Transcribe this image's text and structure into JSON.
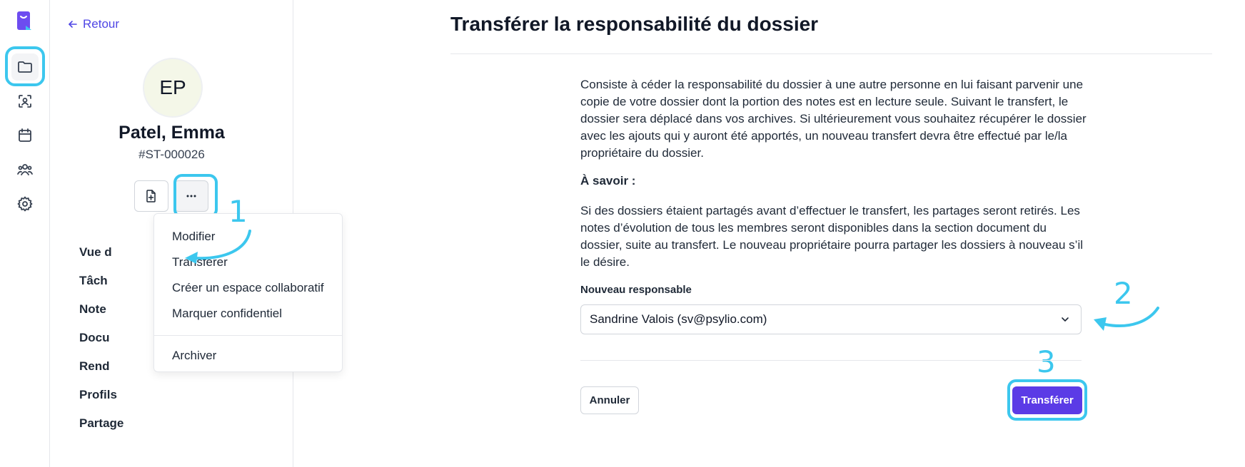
{
  "profile": {
    "back_label": "Retour",
    "initials": "EP",
    "name": "Patel, Emma",
    "file_id": "#ST-000026",
    "sections": [
      "Vue d",
      "Tâch",
      "Note",
      "Docu",
      "Rend",
      "Profils",
      "Partage"
    ]
  },
  "menu": {
    "items": [
      "Modifier",
      "Transférer",
      "Créer un espace collaboratif",
      "Marquer confidentiel"
    ],
    "archive": "Archiver"
  },
  "annotations": {
    "step1": "1",
    "step2": "2",
    "step3": "3",
    "color": "#3cc7ee"
  },
  "main": {
    "title": "Transférer la responsabilité du dossier",
    "description": "Consiste à céder la responsabilité du dossier à une autre personne en lui faisant parvenir une copie de votre dossier dont la portion des notes est en lecture seule. Suivant le transfert, le dossier sera déplacé dans vos archives. Si ultérieurement vous souhaitez récupérer le dossier avec les ajouts qui y auront été apportés, un nouveau transfert devra être effectué par le/la propriétaire du dossier.",
    "know_title": "À savoir :",
    "know_text": "Si des dossiers étaient partagés avant d’effectuer le transfert, les partages seront retirés. Les notes d’évolution de tous les membres seront disponibles dans la section document du dossier, suite au transfert. Le nouveau propriétaire pourra partager les dossiers à nouveau s’il le désire.",
    "field_label": "Nouveau responsable",
    "selected_owner": "Sandrine Valois (sv@psylio.com)",
    "cancel_label": "Annuler",
    "submit_label": "Transférer"
  },
  "colors": {
    "accent": "#5b3be6",
    "link": "#4f46e5",
    "highlight": "#3cc7ee"
  }
}
